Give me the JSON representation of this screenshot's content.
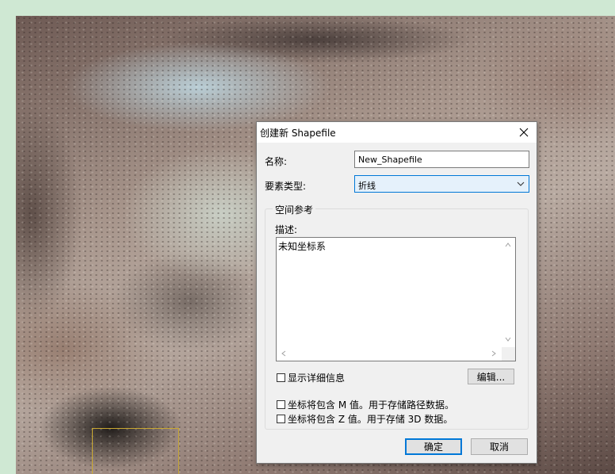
{
  "dialog": {
    "title": "创建新 Shapefile",
    "name_label": "名称:",
    "name_value": "New_Shapefile",
    "feature_type_label": "要素类型:",
    "feature_type_value": "折线",
    "spatial_ref": {
      "legend": "空间参考",
      "description_label": "描述:",
      "description_text": "未知坐标系",
      "show_details_label": "显示详细信息",
      "edit_button": "编辑..."
    },
    "m_values_label": "坐标将包含 M 值。用于存储路径数据。",
    "z_values_label": "坐标将包含 Z 值。用于存储 3D 数据。",
    "ok_button": "确定",
    "cancel_button": "取消"
  },
  "icons": {
    "close": "close-icon",
    "dropdown": "chevron-down-icon"
  },
  "colors": {
    "accent": "#0078d7",
    "dialog_bg": "#f0f0f0",
    "selection_box": "#c9a832"
  }
}
